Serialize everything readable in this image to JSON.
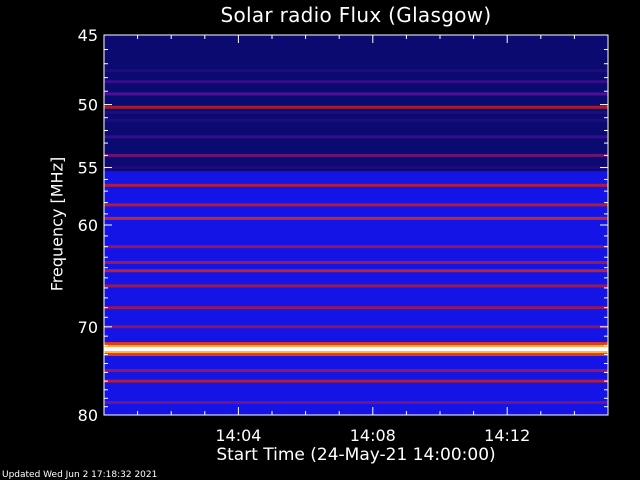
{
  "colors": {
    "background": "#000000",
    "text": "#ffffff",
    "colormap": [
      "#000000",
      "#0a0a70",
      "#1414e6",
      "#1a1aff",
      "#5a10a0",
      "#c81e1e",
      "#ff6a1a",
      "#ffd24a",
      "#ffffff"
    ]
  },
  "footer": "Updated Wed Jun  2 17:18:32 2021",
  "chart_data": {
    "type": "heatmap",
    "title": "Solar radio Flux (Glasgow)",
    "xlabel": "Start Time (24-May-21 14:00:00)",
    "ylabel": "Frequency [MHz]",
    "x_unit": "minutes after 14:00:00",
    "xlim": [
      0,
      15
    ],
    "x_ticks": [
      {
        "value": 4,
        "label": "14:04"
      },
      {
        "value": 8,
        "label": "14:08"
      },
      {
        "value": 12,
        "label": "14:12"
      }
    ],
    "ylim": [
      45,
      80
    ],
    "y_ticks": [
      45,
      50,
      55,
      60,
      70,
      80
    ],
    "y_scale": "log",
    "y_inverted": true,
    "bands": [
      {
        "freq_mhz": 46.0,
        "intensity": 0.15
      },
      {
        "freq_mhz": 47.5,
        "intensity": 0.2
      },
      {
        "freq_mhz": 48.3,
        "intensity": 0.25
      },
      {
        "freq_mhz": 49.2,
        "intensity": 0.3
      },
      {
        "freq_mhz": 50.2,
        "intensity": 0.45
      },
      {
        "freq_mhz": 50.6,
        "intensity": 0.2
      },
      {
        "freq_mhz": 51.2,
        "intensity": 0.2
      },
      {
        "freq_mhz": 52.5,
        "intensity": 0.25
      },
      {
        "freq_mhz": 54.0,
        "intensity": 0.35
      },
      {
        "freq_mhz": 55.0,
        "intensity": 0.2
      },
      {
        "freq_mhz": 56.5,
        "intensity": 0.45
      },
      {
        "freq_mhz": 58.2,
        "intensity": 0.45
      },
      {
        "freq_mhz": 59.4,
        "intensity": 0.5
      },
      {
        "freq_mhz": 62.0,
        "intensity": 0.4
      },
      {
        "freq_mhz": 63.5,
        "intensity": 0.42
      },
      {
        "freq_mhz": 64.3,
        "intensity": 0.48
      },
      {
        "freq_mhz": 65.8,
        "intensity": 0.42
      },
      {
        "freq_mhz": 68.0,
        "intensity": 0.4
      },
      {
        "freq_mhz": 70.0,
        "intensity": 0.38
      },
      {
        "freq_mhz": 72.4,
        "intensity": 1.0
      },
      {
        "freq_mhz": 74.8,
        "intensity": 0.4
      },
      {
        "freq_mhz": 76.0,
        "intensity": 0.45
      },
      {
        "freq_mhz": 78.5,
        "intensity": 0.35
      }
    ]
  }
}
